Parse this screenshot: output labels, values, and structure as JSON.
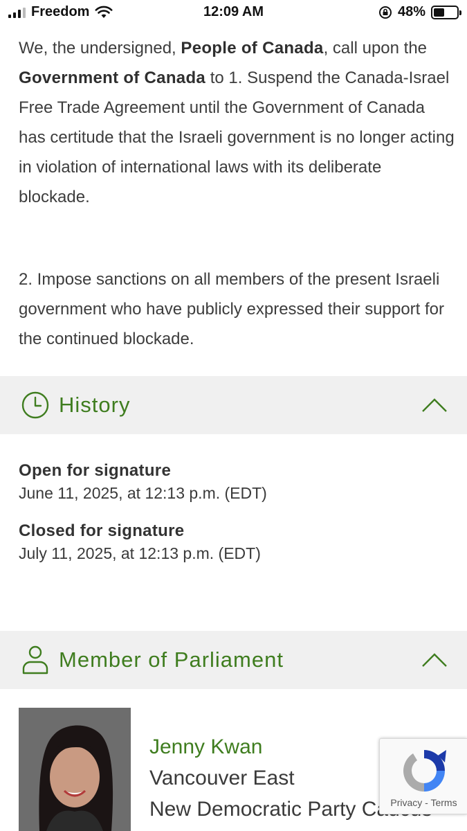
{
  "status_bar": {
    "carrier": "Freedom",
    "time": "12:09 AM",
    "battery_percent": "48%",
    "battery_level": 0.48
  },
  "petition": {
    "p1_intro": "We, the undersigned,",
    "p1_bold1": "People of Canada",
    "p1_mid": ", call upon the",
    "p1_bold2": "Government of Canada",
    "p1_rest": " to 1. Suspend the Canada-Israel Free Trade Agreement until the Government of Canada has certitude that the Israeli government is no longer acting in violation of international laws with its deliberate blockade.",
    "p2": "2. Impose sanctions on all members of the present Israeli government who have publicly expressed their support for the continued blockade."
  },
  "history": {
    "title": "History",
    "items": [
      {
        "label": "Open for signature",
        "value": "June 11, 2025, at 12:13 p.m. (EDT)"
      },
      {
        "label": "Closed for signature",
        "value": "July 11, 2025, at 12:13 p.m. (EDT)"
      }
    ]
  },
  "mp": {
    "title": "Member of Parliament",
    "name": "Jenny Kwan",
    "riding": "Vancouver East",
    "party": "New Democratic Party Caucus"
  },
  "recaptcha": {
    "links": "Privacy - Terms"
  },
  "colors": {
    "accent_green": "#3f7d1f",
    "section_bg": "#f0f0f0"
  }
}
